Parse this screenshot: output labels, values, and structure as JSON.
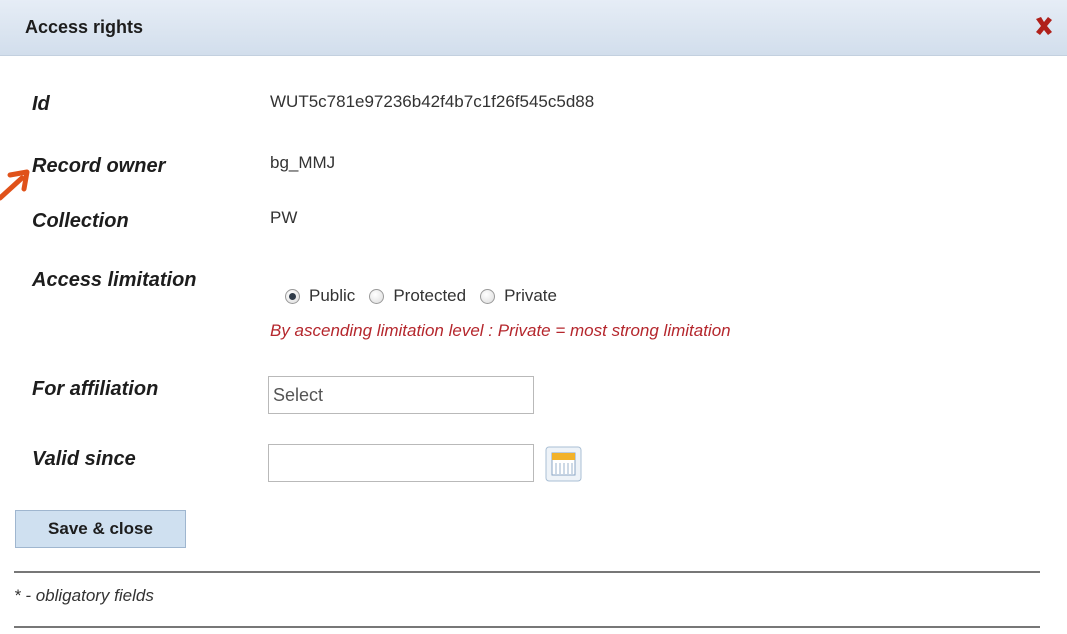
{
  "dialog": {
    "title": "Access rights",
    "close_icon": "close-icon",
    "accent_close_color": "#b0201a"
  },
  "fields": {
    "id_label": "Id",
    "id_value": "WUT5c781e97236b42f4b7c1f26f545c5d88",
    "owner_label": "Record owner",
    "owner_value": "bg_MMJ",
    "collection_label": "Collection",
    "collection_value": "PW",
    "access_label": "Access limitation",
    "access_options": [
      "Public",
      "Protected",
      "Private"
    ],
    "access_selected": "Public",
    "access_hint": "By ascending limitation level : Private = most strong limitation",
    "affiliation_label": "For affiliation",
    "affiliation_value": "Select",
    "valid_since_label": "Valid since",
    "valid_since_value": ""
  },
  "actions": {
    "save_label": "Save & close"
  },
  "footer": {
    "note": "* - obligatory fields"
  },
  "colors": {
    "hint_red": "#b5272d",
    "arrow_orange": "#e0521a",
    "button_bg": "#cfe0f0"
  }
}
